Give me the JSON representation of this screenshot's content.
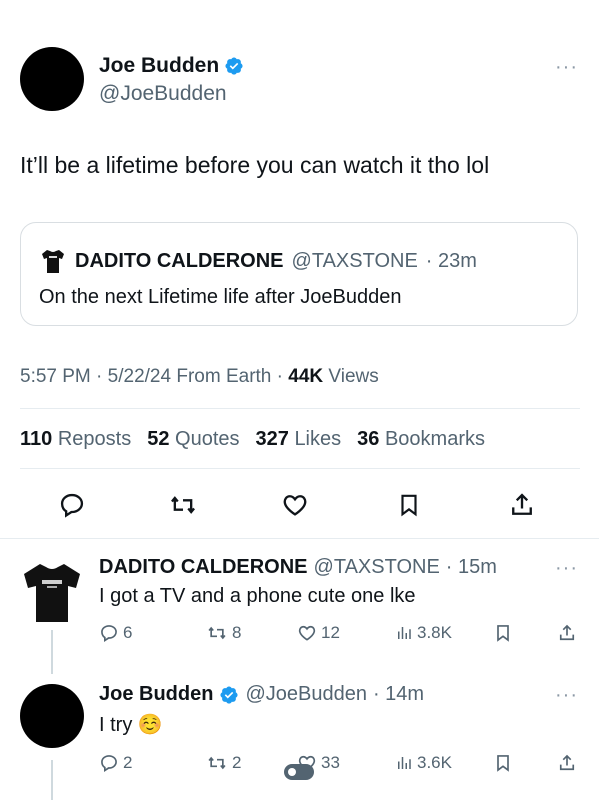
{
  "main_tweet": {
    "author_name": "Joe Budden",
    "handle": "@JoeBudden",
    "text": "It’ll be a lifetime before you can watch it tho lol",
    "more_icon": "more-icon"
  },
  "quoted_tweet": {
    "author_name": "DADITO CALDERONE",
    "handle": "@TAXSTONE",
    "time": "· 23m",
    "text": "On the next Lifetime life after JoeBudden"
  },
  "meta": {
    "time": "5:57 PM",
    "date": "5/22/24",
    "source": "From Earth",
    "views_count": "44K",
    "views_label": "Views",
    "sep": "·"
  },
  "stats": [
    {
      "count": "110",
      "label": "Reposts"
    },
    {
      "count": "52",
      "label": "Quotes"
    },
    {
      "count": "327",
      "label": "Likes"
    },
    {
      "count": "36",
      "label": "Bookmarks"
    }
  ],
  "actions": [
    "reply-icon",
    "repost-icon",
    "like-icon",
    "bookmark-icon",
    "share-icon"
  ],
  "replies": [
    {
      "author_name": "DADITO CALDERONE",
      "handle": "@TAXSTONE",
      "time": "· 15m",
      "text": "I got a TV and a phone cute one lke",
      "reply_count": "6",
      "repost_count": "8",
      "like_count": "12",
      "views": "3.8K"
    },
    {
      "author_name": "Joe Budden",
      "handle": "@JoeBudden",
      "time": "· 14m",
      "text": "I try",
      "emoji": "☺️",
      "reply_count": "2",
      "repost_count": "2",
      "like_count": "33",
      "views": "3.6K"
    }
  ],
  "colors": {
    "verified": "#1d9bf0",
    "text": "#0f1419",
    "secondary": "#536471",
    "border": "#d9dee2"
  }
}
